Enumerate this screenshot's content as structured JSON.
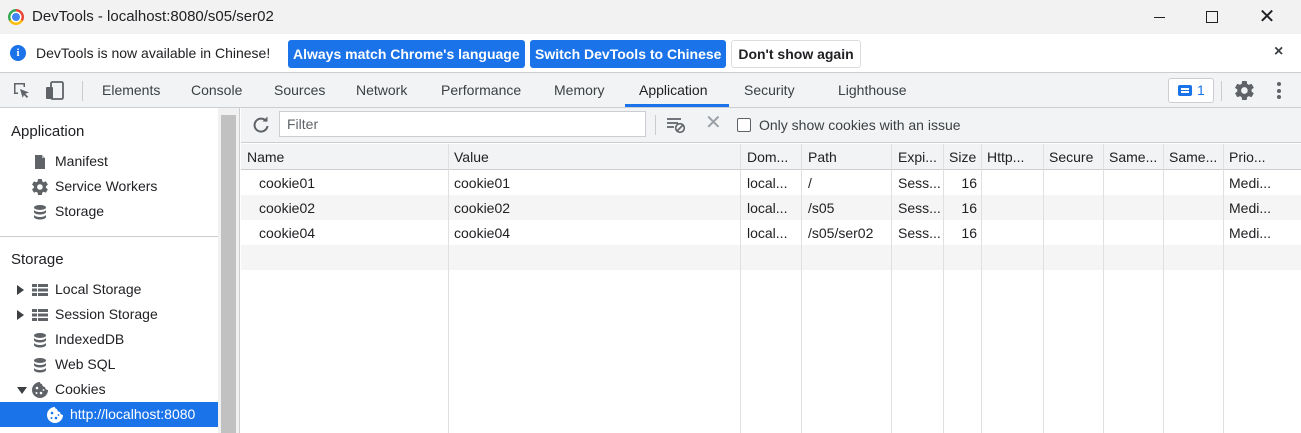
{
  "window": {
    "title": "DevTools - localhost:8080/s05/ser02"
  },
  "infobar": {
    "message": "DevTools is now available in Chinese!",
    "match_button": "Always match Chrome's language",
    "switch_button": "Switch DevTools to Chinese",
    "dismiss_button": "Don't show again",
    "close_glyph": "×"
  },
  "tabs": [
    {
      "label": "Elements"
    },
    {
      "label": "Console"
    },
    {
      "label": "Sources"
    },
    {
      "label": "Network"
    },
    {
      "label": "Performance"
    },
    {
      "label": "Memory"
    },
    {
      "label": "Application",
      "active": true
    },
    {
      "label": "Security"
    },
    {
      "label": "Lighthouse"
    }
  ],
  "issues": {
    "count": "1"
  },
  "sidebar": {
    "application_header": "Application",
    "application_items": [
      {
        "label": "Manifest",
        "icon": "file-icon"
      },
      {
        "label": "Service Workers",
        "icon": "gear-icon"
      },
      {
        "label": "Storage",
        "icon": "database-icon"
      }
    ],
    "storage_header": "Storage",
    "storage_items": [
      {
        "label": "Local Storage",
        "icon": "grid-icon",
        "expandable": true
      },
      {
        "label": "Session Storage",
        "icon": "grid-icon",
        "expandable": true
      },
      {
        "label": "IndexedDB",
        "icon": "database-icon"
      },
      {
        "label": "Web SQL",
        "icon": "database-icon"
      },
      {
        "label": "Cookies",
        "icon": "cookie-icon",
        "expanded": true
      },
      {
        "label": "http://localhost:8080",
        "icon": "cookie-icon",
        "selected": true
      }
    ]
  },
  "toolbar": {
    "filter_placeholder": "Filter",
    "delete_glyph": "✕",
    "issue_checkbox_label": "Only show cookies with an issue"
  },
  "table": {
    "columns": [
      "Name",
      "Value",
      "Dom...",
      "Path",
      "Expi...",
      "Size",
      "Http...",
      "Secure",
      "Same...",
      "Same...",
      "Prio..."
    ],
    "rows": [
      [
        "cookie01",
        "cookie01",
        "local...",
        "/",
        "Sess...",
        "16",
        "",
        "",
        "",
        "",
        "Medi..."
      ],
      [
        "cookie02",
        "cookie02",
        "local...",
        "/s05",
        "Sess...",
        "16",
        "",
        "",
        "",
        "",
        "Medi..."
      ],
      [
        "cookie04",
        "cookie04",
        "local...",
        "/s05/ser02",
        "Sess...",
        "16",
        "",
        "",
        "",
        "",
        "Medi..."
      ]
    ]
  },
  "colors": {
    "accent": "#1a73e8",
    "toolbar_bg": "#f1f3f4",
    "titlebar_bg": "#f2f2f2"
  }
}
